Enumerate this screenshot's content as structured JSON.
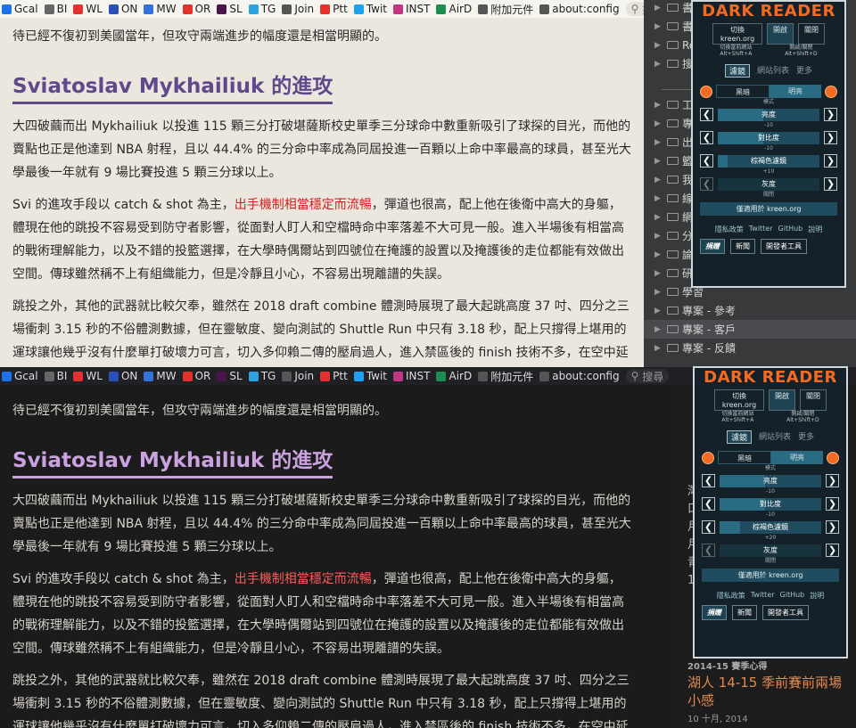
{
  "bookmarks": [
    {
      "label": "Gcal",
      "color": "#1a73e8"
    },
    {
      "label": "BI",
      "color": "#666666"
    },
    {
      "label": "WL",
      "color": "#e5312e"
    },
    {
      "label": "ON",
      "color": "#2a4fb8"
    },
    {
      "label": "MW",
      "color": "#3273dc"
    },
    {
      "label": "OR",
      "color": "#e5312e"
    },
    {
      "label": "SL",
      "color": "#4a154b"
    },
    {
      "label": "TG",
      "color": "#2aa3e0"
    },
    {
      "label": "Join",
      "color": "#555555"
    },
    {
      "label": "Ptt",
      "color": "#e5312e"
    },
    {
      "label": "Twit",
      "color": "#1da1f2"
    },
    {
      "label": "INST",
      "color": "#c13584"
    },
    {
      "label": "AirD",
      "color": "#1c8e4f"
    },
    {
      "label": "附加元件",
      "color": "#555555"
    },
    {
      "label": "about:config",
      "color": "#555555"
    }
  ],
  "search_placeholder": "搜尋",
  "article": {
    "intro": "待已經不復初到美國當年，但攻守兩端進步的幅度還是相當明顯的。",
    "heading": "Sviatoslav Mykhailiuk 的進攻",
    "para1": "大四破繭而出 Mykhailiuk 以投進 115 顆三分打破堪薩斯校史單季三分球命中數重新吸引了球探的目光，而他的賣點也正是他達到 NBA 射程，且以 44.4% 的三分命中率成為同屆投進一百顆以上命中率最高的球員，甚至光大學最後一年就有 9 場比賽投進 5 顆三分球以上。",
    "para2_a": "Svi 的進攻手段以 catch & shot 為主，",
    "para2_red": "出手機制相當穩定而流暢",
    "para2_b": "，彈道也很高，配上他在後衛中高大的身軀，體現在他的跳投不容易受到防守者影響，從面對人盯人和空檔時命中率落差不大可見一般。進入半場後有相當高的戰術理解能力，以及不錯的投籃選擇，在大學時偶爾站到四號位在掩護的設置以及掩護後的走位都能有效做出空間。傳球雖然稱不上有組織能力，但是冷靜且小心，不容易出現離譜的失誤。",
    "para3": "跳投之外，其他的武器就比較欠奉，雖然在 2018 draft combine 體測時展現了最大起跳高度 37 吋、四分之三場衝刺 3.15 秒的不俗體測數據，但在靈敏度、變向測試的 Shuttle Run 中只有 3.18 秒，配上只撐得上堪用的運球讓他幾乎沒有什麼單打破壞力可言，切入多仰賴二傳的壓肩過人，進入禁區後的 finish 技術不多，在空中延展能力不夠，"
  },
  "sidebar_top": {
    "items": [
      "書籤",
      "書籤",
      "Red",
      "搜尋",
      "",
      "工作",
      "專案",
      "出差",
      "籃球",
      "我的",
      "線上",
      "網路",
      "分類",
      "論壇",
      "研究",
      "學習",
      "專案 - 參考",
      "專案 - 客戶",
      "專案 - 反饋"
    ]
  },
  "sidebar_bottom": {
    "category": "2014-15 賽季心得",
    "title": "湖人 14-15 季前賽前兩場小感",
    "date": "10 十月, 2014",
    "left_chars": [
      "灣",
      "口",
      "月",
      "月",
      "青",
      "10"
    ]
  },
  "dark_reader": {
    "logo": "DARK READER",
    "site": "kreen.org",
    "toggle_site_label": "切換 kreen.org",
    "on": "開啟",
    "off": "關閉",
    "hint_left": "切換當前網站",
    "shortcut_left": "Alt+Shift+A",
    "hint_right": "開啟/關閉",
    "shortcut_right": "Alt+Shift+D",
    "tab_filter": "濾鏡",
    "tab_sites": "網站列表",
    "tab_more": "更多",
    "mode_dark": "黑暗",
    "mode_light": "明亮",
    "mode_label": "模式",
    "brightness": "亮度",
    "contrast": "對比度",
    "sepia": "棕褐色濾鏡",
    "grayscale": "灰度",
    "off_text": "關閉",
    "apply_site": "僅適用於 kreen.org",
    "link_privacy": "隱私政策",
    "link_twitter": "Twitter",
    "link_github": "GitHub",
    "link_help": "說明",
    "donate": "捐贈",
    "news": "新聞",
    "devtools": "開發者工具",
    "panel1": {
      "brightness": "-10",
      "contrast": "-10",
      "sepia": "+10",
      "brightness_level": 0.45,
      "contrast_level": 0.45,
      "sepia_level": 0.1
    },
    "panel2": {
      "brightness": "-10",
      "contrast": "-10",
      "sepia": "+20",
      "brightness_level": 0.45,
      "contrast_level": 0.45,
      "sepia_level": 0.2
    }
  }
}
